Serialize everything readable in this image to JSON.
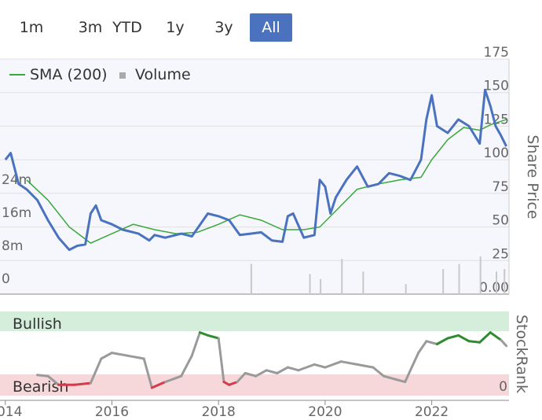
{
  "range_buttons": [
    {
      "label": "1m",
      "selected": false
    },
    {
      "label": "3m",
      "selected": false
    },
    {
      "label": "YTD",
      "selected": false
    },
    {
      "label": "1y",
      "selected": false
    },
    {
      "label": "3y",
      "selected": false
    },
    {
      "label": "All",
      "selected": true
    }
  ],
  "legend": {
    "sma": "SMA (200)",
    "volume": "Volume"
  },
  "colors": {
    "price": "#4a72bf",
    "sma": "#3aa83a",
    "volume": "#c8c8c8",
    "bullish": "#2e8b2e",
    "bearish": "#d33c4a",
    "neutral": "#9a9a9a",
    "bull_band": "#d5eedc",
    "bear_band": "#f6d7da",
    "accent": "#4a72bf"
  },
  "chart_data": [
    {
      "type": "line",
      "title": "",
      "ylabel": "Share Price",
      "ylim": [
        0,
        175
      ],
      "yticks": [
        "0.00",
        "25",
        "50",
        "75",
        "100",
        "125",
        "150",
        "175"
      ],
      "y2ticks": [
        "0",
        "8m",
        "16m",
        "24m"
      ],
      "x_ticks": [
        "2014",
        "2016",
        "2018",
        "2020",
        "2022"
      ],
      "series": [
        {
          "name": "Price",
          "x": [
            2014.0,
            2014.1,
            2014.25,
            2014.4,
            2014.6,
            2014.8,
            2015.0,
            2015.2,
            2015.35,
            2015.5,
            2015.6,
            2015.7,
            2015.8,
            2016.0,
            2016.2,
            2016.5,
            2016.7,
            2016.8,
            2017.0,
            2017.3,
            2017.5,
            2017.8,
            2018.0,
            2018.2,
            2018.4,
            2018.6,
            2018.8,
            2019.0,
            2019.2,
            2019.3,
            2019.4,
            2019.6,
            2019.8,
            2019.9,
            2020.0,
            2020.1,
            2020.2,
            2020.4,
            2020.6,
            2020.8,
            2021.0,
            2021.2,
            2021.4,
            2021.6,
            2021.8,
            2021.9,
            2022.0,
            2022.1,
            2022.3,
            2022.5,
            2022.7,
            2022.9,
            2023.0,
            2023.1,
            2023.2,
            2023.3,
            2023.4
          ],
          "values": [
            100,
            105,
            82,
            78,
            70,
            55,
            42,
            33,
            36,
            37,
            60,
            66,
            55,
            52,
            48,
            45,
            40,
            44,
            42,
            45,
            43,
            60,
            58,
            55,
            44,
            45,
            46,
            40,
            39,
            58,
            60,
            42,
            44,
            85,
            80,
            60,
            72,
            85,
            95,
            80,
            82,
            90,
            88,
            85,
            100,
            130,
            148,
            125,
            120,
            130,
            125,
            112,
            152,
            140,
            125,
            118,
            110
          ]
        },
        {
          "name": "SMA (200)",
          "x": [
            2014.4,
            2014.8,
            2015.2,
            2015.6,
            2016.0,
            2016.4,
            2016.8,
            2017.2,
            2017.6,
            2018.0,
            2018.4,
            2018.8,
            2019.2,
            2019.6,
            2019.9,
            2020.2,
            2020.6,
            2021.0,
            2021.4,
            2021.8,
            2022.0,
            2022.3,
            2022.6,
            2022.9,
            2023.1,
            2023.4
          ],
          "values": [
            85,
            70,
            50,
            38,
            45,
            52,
            48,
            45,
            46,
            52,
            59,
            55,
            48,
            48,
            50,
            62,
            78,
            82,
            85,
            87,
            100,
            115,
            124,
            122,
            126,
            130
          ]
        }
      ],
      "volume": {
        "x": [
          2018.6,
          2019.7,
          2019.9,
          2020.3,
          2020.7,
          2021.5,
          2022.2,
          2022.5,
          2022.9,
          2023.2,
          2023.35
        ],
        "values": [
          12,
          8,
          6,
          14,
          9,
          4,
          10,
          12,
          15,
          9,
          10
        ]
      }
    },
    {
      "type": "line",
      "title": "",
      "ylabel": "StockRank",
      "ylim": [
        0,
        100
      ],
      "yticks": [
        "0"
      ],
      "bands": [
        "Bullish",
        "Bearish"
      ],
      "x": [
        2014.6,
        2014.8,
        2015.0,
        2015.3,
        2015.6,
        2015.8,
        2016.0,
        2016.3,
        2016.6,
        2016.75,
        2016.8,
        2017.0,
        2017.3,
        2017.5,
        2017.65,
        2017.8,
        2018.0,
        2018.1,
        2018.2,
        2018.35,
        2018.5,
        2018.7,
        2018.9,
        2019.1,
        2019.3,
        2019.5,
        2019.8,
        2020.0,
        2020.3,
        2020.6,
        2020.9,
        2021.1,
        2021.3,
        2021.5,
        2021.6,
        2021.75,
        2021.9,
        2022.1,
        2022.3,
        2022.5,
        2022.7,
        2022.9,
        2023.1,
        2023.3,
        2023.4
      ],
      "values": [
        22,
        20,
        5,
        5,
        8,
        50,
        60,
        55,
        50,
        0,
        2,
        10,
        20,
        55,
        95,
        90,
        85,
        10,
        5,
        10,
        25,
        20,
        30,
        25,
        35,
        30,
        40,
        35,
        45,
        40,
        35,
        20,
        15,
        10,
        30,
        60,
        80,
        75,
        85,
        90,
        80,
        78,
        95,
        82,
        72
      ]
    }
  ]
}
